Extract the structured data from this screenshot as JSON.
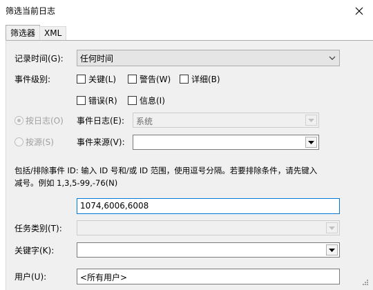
{
  "window": {
    "title": "筛选当前日志"
  },
  "tabs": [
    {
      "label": "筛选器",
      "active": true
    },
    {
      "label": "XML",
      "active": false
    }
  ],
  "filter": {
    "logged": {
      "label": "记录时间(G):",
      "value": "任何时间"
    },
    "event_level": {
      "label": "事件级别:",
      "options": [
        {
          "label": "关键(L)",
          "checked": false
        },
        {
          "label": "警告(W)",
          "checked": false
        },
        {
          "label": "详细(B)",
          "checked": false
        },
        {
          "label": "错误(R)",
          "checked": false
        },
        {
          "label": "信息(I)",
          "checked": false
        }
      ]
    },
    "by_log": {
      "label": "按日志(O)",
      "selected": true,
      "enabled": false
    },
    "by_source": {
      "label": "按源(S)",
      "selected": false,
      "enabled": false
    },
    "event_logs": {
      "label": "事件日志(E):",
      "value": "系统"
    },
    "event_sources": {
      "label": "事件来源(V):",
      "value": ""
    },
    "event_ids": {
      "hint_line1": "包括/排除事件 ID: 输入 ID 号和/或 ID 范围，使用逗号分隔。若要排除条件，请先键入",
      "hint_line2": "减号。例如 1,3,5-99,-76(N)",
      "value": "1074,6006,6008"
    },
    "task_category": {
      "label": "任务类别(T):",
      "value": ""
    },
    "keywords": {
      "label": "关键字(K):",
      "value": ""
    },
    "user": {
      "label": "用户(U):",
      "value": "<所有用户>"
    }
  },
  "colors": {
    "focus_border": "#0078d7",
    "panel_bg": "#f0f0f0"
  }
}
